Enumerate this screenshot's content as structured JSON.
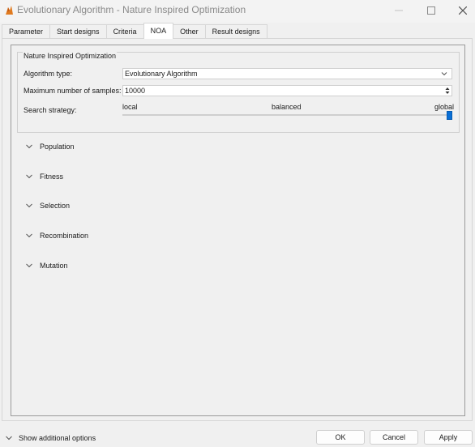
{
  "window": {
    "title": "Evolutionary Algorithm - Nature Inspired Optimization",
    "icon": "matlab-icon"
  },
  "tabs": [
    {
      "label": "Parameter",
      "active": false
    },
    {
      "label": "Start designs",
      "active": false
    },
    {
      "label": "Criteria",
      "active": false
    },
    {
      "label": "NOA",
      "active": true
    },
    {
      "label": "Other",
      "active": false
    },
    {
      "label": "Result designs",
      "active": false
    }
  ],
  "noa": {
    "group_title": "Nature Inspired Optimization",
    "algorithm_type_label": "Algorithm type:",
    "algorithm_type_value": "Evolutionary Algorithm",
    "max_samples_label": "Maximum number of samples:",
    "max_samples_value": "10000",
    "search_strategy_label": "Search strategy:",
    "strategy_labels": {
      "left": "local",
      "center": "balanced",
      "right": "global"
    },
    "strategy_level": "global",
    "accent_color": "#0a6fd6"
  },
  "sections": [
    {
      "label": "Population"
    },
    {
      "label": "Fitness"
    },
    {
      "label": "Selection"
    },
    {
      "label": "Recombination"
    },
    {
      "label": "Mutation"
    }
  ],
  "footer": {
    "toggle_label": "Show additional options",
    "ok_label": "OK",
    "cancel_label": "Cancel",
    "apply_label": "Apply"
  }
}
